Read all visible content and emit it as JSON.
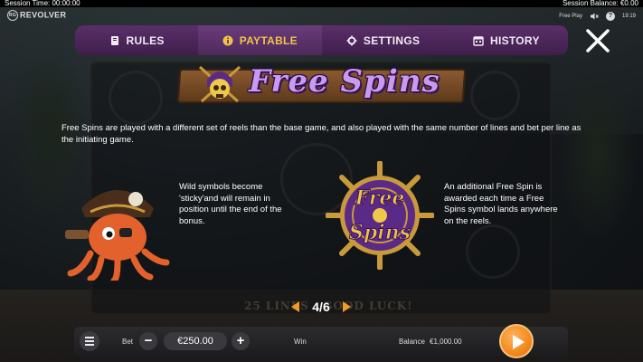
{
  "topbar": {
    "session_time": "Session Time: 00:00:00",
    "session_balance": "Session Balance: €0.00"
  },
  "brand": {
    "logo_text": "REVOLVER",
    "badge_text": "RG"
  },
  "status": {
    "mode": "Free Play",
    "help": "?",
    "clock": "19:19"
  },
  "tabs": [
    {
      "label": "RULES",
      "icon": "book-icon",
      "active": false
    },
    {
      "label": "PAYTABLE",
      "icon": "info-icon",
      "active": true
    },
    {
      "label": "SETTINGS",
      "icon": "gear-icon",
      "active": false
    },
    {
      "label": "HISTORY",
      "icon": "calendar-icon",
      "active": false
    }
  ],
  "page": {
    "title": "Free Spins",
    "description": "Free Spins are played with a different set of reels than the base game, and also played with the same number of lines and bet per line as the initiating game.",
    "wild_text": "Wild symbols become 'sticky'and will remain in position until the end of the bonus.",
    "free_spin_text": "An additional Free Spin is awarded each time a Free Spins symbol lands anywhere on the reels.",
    "wheel_line1": "Free",
    "wheel_line2": "Spins",
    "pager": "4/6",
    "background_banner": "25 LINES · GOOD LUCK!"
  },
  "bottombar": {
    "bet_label": "Bet",
    "bet_value": "€250.00",
    "minus": "−",
    "plus": "+",
    "win_label": "Win",
    "balance_label": "Balance",
    "balance_value": "€1,000.00"
  },
  "colors": {
    "tab_bg": "#4a2558",
    "tab_active_text": "#f3c24a",
    "accent_orange": "#f28a1e",
    "title_purple": "#c99bf0"
  }
}
